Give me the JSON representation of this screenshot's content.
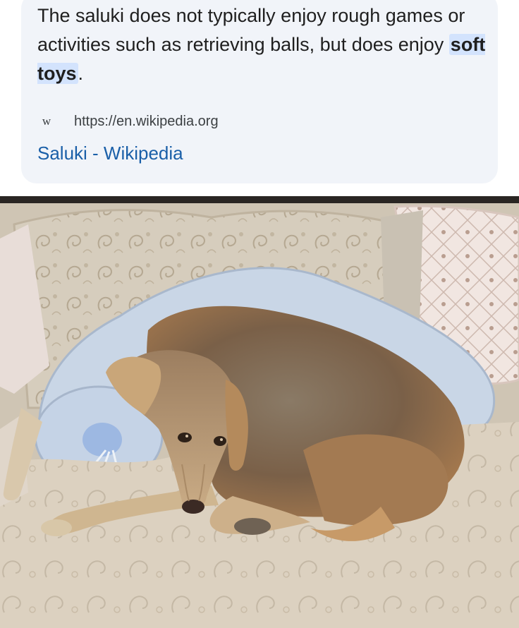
{
  "snippet": {
    "text_before": "The saluki does not typically enjoy rough games or activities such as retrieving balls, but does enjoy ",
    "highlight": "soft toys",
    "text_after": ".",
    "favicon": "W",
    "source_url": "https://en.wikipedia.org",
    "source_title": "Saluki - Wikipedia"
  },
  "photo": {
    "icon": "saluki-photo"
  },
  "colors": {
    "card_bg": "#f1f4f9",
    "highlight_bg": "#d3e3fd",
    "link": "#1a5fa8"
  }
}
